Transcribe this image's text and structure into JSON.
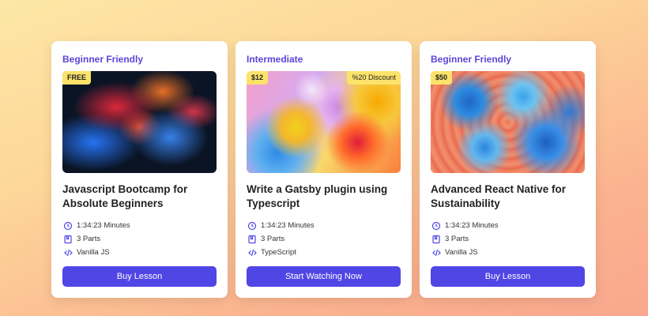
{
  "cards": [
    {
      "level": "Beginner Friendly",
      "badge_left": "FREE",
      "badge_right": "",
      "image": "colorful-smoke-image",
      "title": "Javascript Bootcamp for Absolute Beginners",
      "duration": "1:34:23 Minutes",
      "parts": "3 Parts",
      "tech": "Vanilla JS",
      "button": "Buy Lesson"
    },
    {
      "level": "Intermediate",
      "badge_left": "$12",
      "badge_right": "%20 Discount",
      "image": "colorful-bubbles-image",
      "title": "Write a Gatsby plugin using Typescript",
      "duration": "1:34:23 Minutes",
      "parts": "3 Parts",
      "tech": "TypeScript",
      "button": "Start Watching Now"
    },
    {
      "level": "Beginner Friendly",
      "badge_left": "$50",
      "badge_right": "",
      "image": "marbled-paint-image",
      "title": "Advanced React Native for Sustainability",
      "duration": "1:34:23 Minutes",
      "parts": "3 Parts",
      "tech": "Vanilla JS",
      "button": "Buy Lesson"
    }
  ],
  "icons": {
    "duration": "clock-icon",
    "parts": "book-icon",
    "tech": "code-icon"
  },
  "colors": {
    "accent": "#5b44d6",
    "button": "#5046e5",
    "badge": "#fbe36b"
  }
}
